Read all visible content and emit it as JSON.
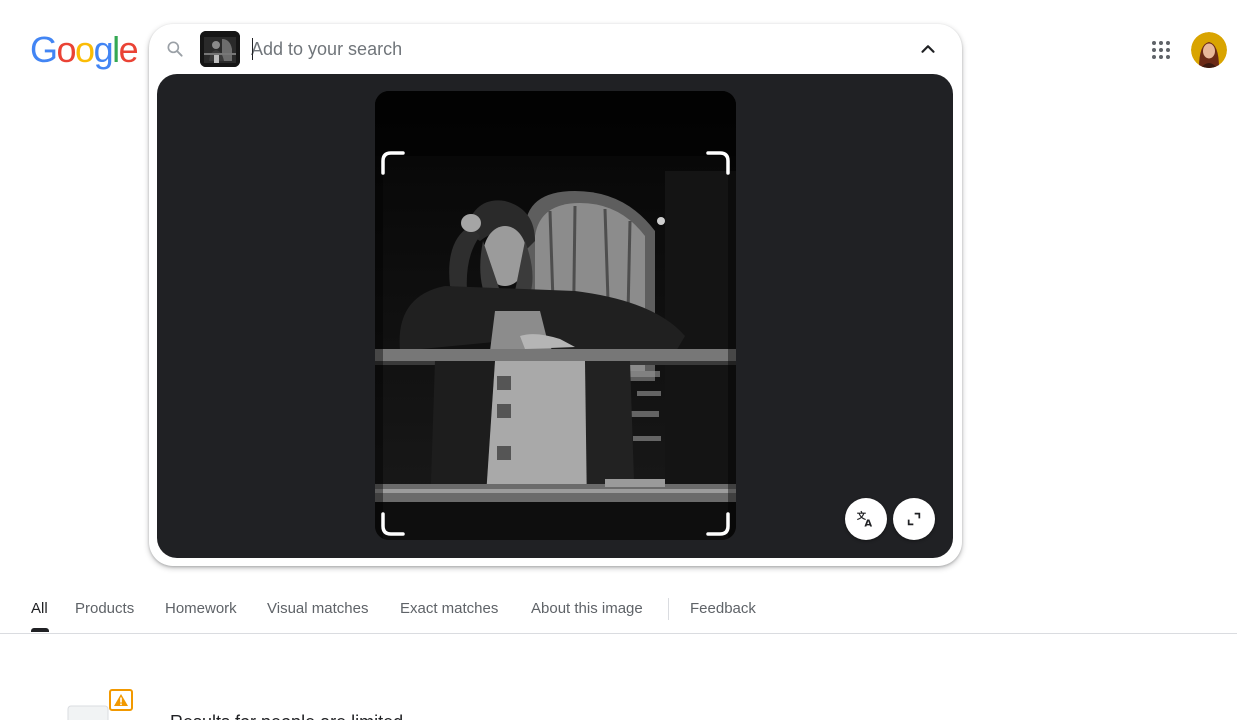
{
  "logo": {
    "letters": [
      "G",
      "o",
      "o",
      "g",
      "l",
      "e"
    ]
  },
  "search": {
    "placeholder": "Add to your search",
    "value": ""
  },
  "tabs": {
    "items": [
      {
        "label": "All",
        "active": true
      },
      {
        "label": "Products"
      },
      {
        "label": "Homework"
      },
      {
        "label": "Visual matches"
      },
      {
        "label": "Exact matches"
      },
      {
        "label": "About this image"
      }
    ],
    "feedback_label": "Feedback"
  },
  "results": {
    "notice_text": "Results for people are limited"
  },
  "icons": {
    "search": "search-icon",
    "collapse": "chevron-up-icon",
    "translate": "translate-icon",
    "expand": "expand-icon",
    "apps": "apps-grid-icon",
    "warning": "warning-icon"
  },
  "colors": {
    "logo_blue": "#4285F4",
    "logo_red": "#EA4335",
    "logo_yellow": "#FBBC05",
    "logo_green": "#34A853",
    "panel_bg": "#202124",
    "warning": "#F29900"
  }
}
